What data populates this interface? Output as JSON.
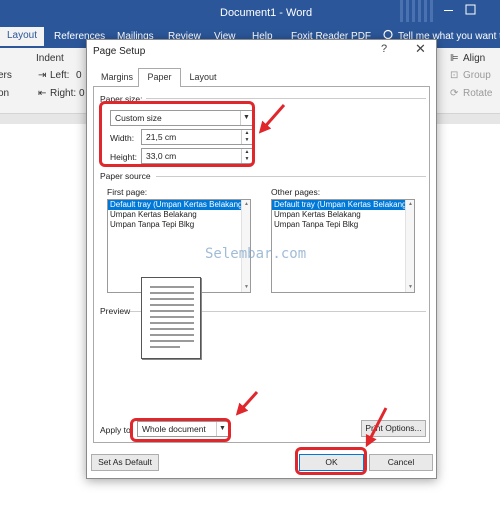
{
  "word": {
    "document_title": "Document1 - Word",
    "active_tab": "Layout",
    "tabs": [
      "References",
      "Mailings",
      "Review",
      "View",
      "Help",
      "Foxit Reader PDF"
    ],
    "tell_me": "Tell me what you want to",
    "ribbon": {
      "indent_label": "Indent",
      "left_label": "Left:",
      "right_label": "Right:",
      "left_value": "0",
      "right_value": "0",
      "left_fragment": "ers",
      "left_fragment2": "on",
      "align_label": "Align",
      "group_label": "Group",
      "rotate_label": "Rotate"
    }
  },
  "dialog": {
    "title": "Page Setup",
    "help": "?",
    "close": "✕",
    "tabs": {
      "margins": "Margins",
      "paper": "Paper",
      "layout": "Layout"
    },
    "paper_size": {
      "section_label": "Paper size:",
      "selected": "Custom size",
      "width_label": "Width:",
      "width_value": "21,5 cm",
      "height_label": "Height:",
      "height_value": "33,0 cm"
    },
    "paper_source": {
      "section_label": "Paper source",
      "first_page_label": "First page:",
      "other_pages_label": "Other pages:",
      "first_page_items": [
        "Default tray (Umpan Kertas Belakang)",
        "Umpan Kertas Belakang",
        "Umpan Tanpa Tepi Blkg"
      ],
      "other_pages_items": [
        "Default tray (Umpan Kertas Belakang)",
        "Umpan Kertas Belakang",
        "Umpan Tanpa Tepi Blkg"
      ],
      "selected_index": 0
    },
    "preview_label": "Preview",
    "apply_to_label": "Apply to:",
    "apply_to_value": "Whole document",
    "print_options_label": "Print Options...",
    "set_default_label": "Set As Default",
    "ok_label": "OK",
    "cancel_label": "Cancel"
  },
  "watermark": "Selembar.com",
  "colors": {
    "word_blue": "#2b579a",
    "highlight_red": "#e0272c",
    "selection_blue": "#0078d7"
  }
}
